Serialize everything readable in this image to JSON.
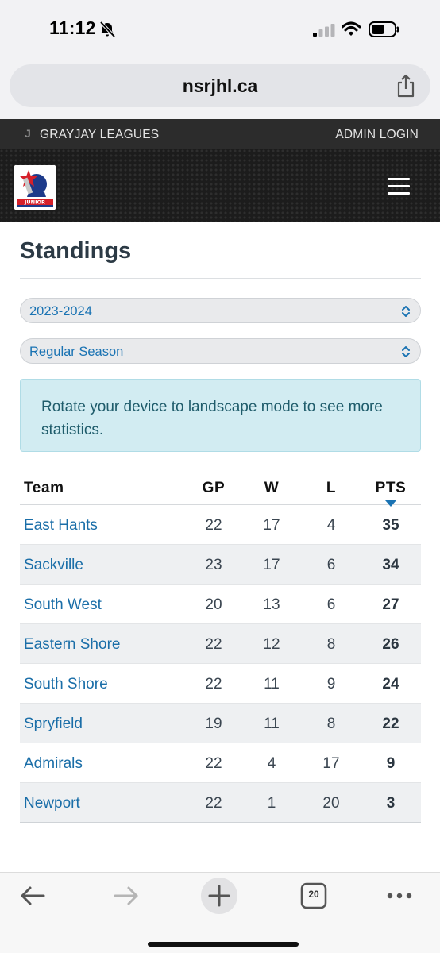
{
  "status_bar": {
    "time": "11:12"
  },
  "browser": {
    "url": "nsrjhl.ca",
    "tab_count": "20"
  },
  "league_bar": {
    "logo": "J",
    "name": "GRAYJAY LEAGUES",
    "admin_login": "ADMIN LOGIN"
  },
  "logo_text": "JUNIOR",
  "page": {
    "title": "Standings"
  },
  "filters": {
    "season": "2023-2024",
    "season_type": "Regular Season"
  },
  "alert": {
    "text": "Rotate your device to landscape mode to see more statistics."
  },
  "table": {
    "headers": {
      "team": "Team",
      "gp": "GP",
      "w": "W",
      "l": "L",
      "pts": "PTS"
    },
    "sort_column": "PTS",
    "rows": [
      {
        "team": "East Hants",
        "gp": "22",
        "w": "17",
        "l": "4",
        "pts": "35"
      },
      {
        "team": "Sackville",
        "gp": "23",
        "w": "17",
        "l": "6",
        "pts": "34"
      },
      {
        "team": "South West",
        "gp": "20",
        "w": "13",
        "l": "6",
        "pts": "27"
      },
      {
        "team": "Eastern Shore",
        "gp": "22",
        "w": "12",
        "l": "8",
        "pts": "26"
      },
      {
        "team": "South Shore",
        "gp": "22",
        "w": "11",
        "l": "9",
        "pts": "24"
      },
      {
        "team": "Spryfield",
        "gp": "19",
        "w": "11",
        "l": "8",
        "pts": "22"
      },
      {
        "team": "Admirals",
        "gp": "22",
        "w": "4",
        "l": "17",
        "pts": "9"
      },
      {
        "team": "Newport",
        "gp": "22",
        "w": "1",
        "l": "20",
        "pts": "3"
      }
    ]
  },
  "colors": {
    "link": "#1a6ea8",
    "alert_bg": "#d2ecf2",
    "header_bg": "#1c1c1c",
    "league_bar_bg": "#2c2c2c"
  },
  "icons": [
    "bell-slash-icon",
    "signal-icon",
    "wifi-icon",
    "battery-icon",
    "share-icon",
    "hamburger-icon",
    "chevron-updown-icon",
    "back-arrow-icon",
    "forward-arrow-icon",
    "plus-icon",
    "tabs-icon",
    "more-icon"
  ]
}
